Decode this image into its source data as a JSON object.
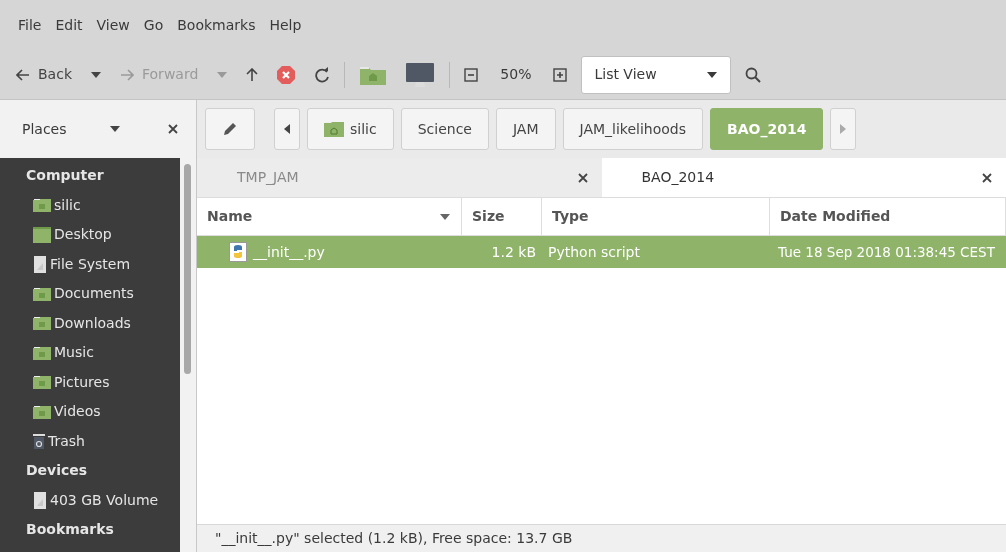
{
  "menu": [
    "File",
    "Edit",
    "View",
    "Go",
    "Bookmarks",
    "Help"
  ],
  "toolbar": {
    "back": {
      "label": "Back",
      "disabled": false
    },
    "forward": {
      "label": "Forward",
      "disabled": true
    },
    "zoom": "50%",
    "view_mode": "List View"
  },
  "places": {
    "label": "Places"
  },
  "path": [
    {
      "label": "silic",
      "kind": "home",
      "selected": false
    },
    {
      "label": "Science",
      "kind": "plain",
      "selected": false
    },
    {
      "label": "JAM",
      "kind": "plain",
      "selected": false
    },
    {
      "label": "JAM_likelihoods",
      "kind": "plain",
      "selected": false
    },
    {
      "label": "BAO_2014",
      "kind": "plain",
      "selected": true
    }
  ],
  "sidebar": [
    {
      "title": "Computer",
      "items": [
        {
          "label": "silic",
          "kind": "folder"
        },
        {
          "label": "Desktop",
          "kind": "desktop"
        },
        {
          "label": "File System",
          "kind": "drive"
        },
        {
          "label": "Documents",
          "kind": "folder"
        },
        {
          "label": "Downloads",
          "kind": "folder"
        },
        {
          "label": "Music",
          "kind": "folder"
        },
        {
          "label": "Pictures",
          "kind": "folder"
        },
        {
          "label": "Videos",
          "kind": "folder"
        },
        {
          "label": "Trash",
          "kind": "trash"
        }
      ]
    },
    {
      "title": "Devices",
      "items": [
        {
          "label": "403 GB Volume",
          "kind": "drive"
        }
      ]
    },
    {
      "title": "Bookmarks"
    }
  ],
  "tabs": [
    {
      "label": "TMP_JAM",
      "selected": false
    },
    {
      "label": "BAO_2014",
      "selected": true
    }
  ],
  "table": {
    "columns": [
      {
        "label": "Name",
        "sorted": true
      },
      {
        "label": "Size",
        "sorted": false
      },
      {
        "label": "Type",
        "sorted": false
      },
      {
        "label": "Date Modified",
        "sorted": false
      }
    ],
    "rows": [
      {
        "name": "__init__.py",
        "size": "1.2 kB",
        "type": "Python script",
        "modified": "Tue 18 Sep 2018 01:38:45 CEST",
        "selected": true
      }
    ]
  },
  "status_bar": "\"__init__.py\" selected (1.2 kB), Free space: 13.7 GB"
}
